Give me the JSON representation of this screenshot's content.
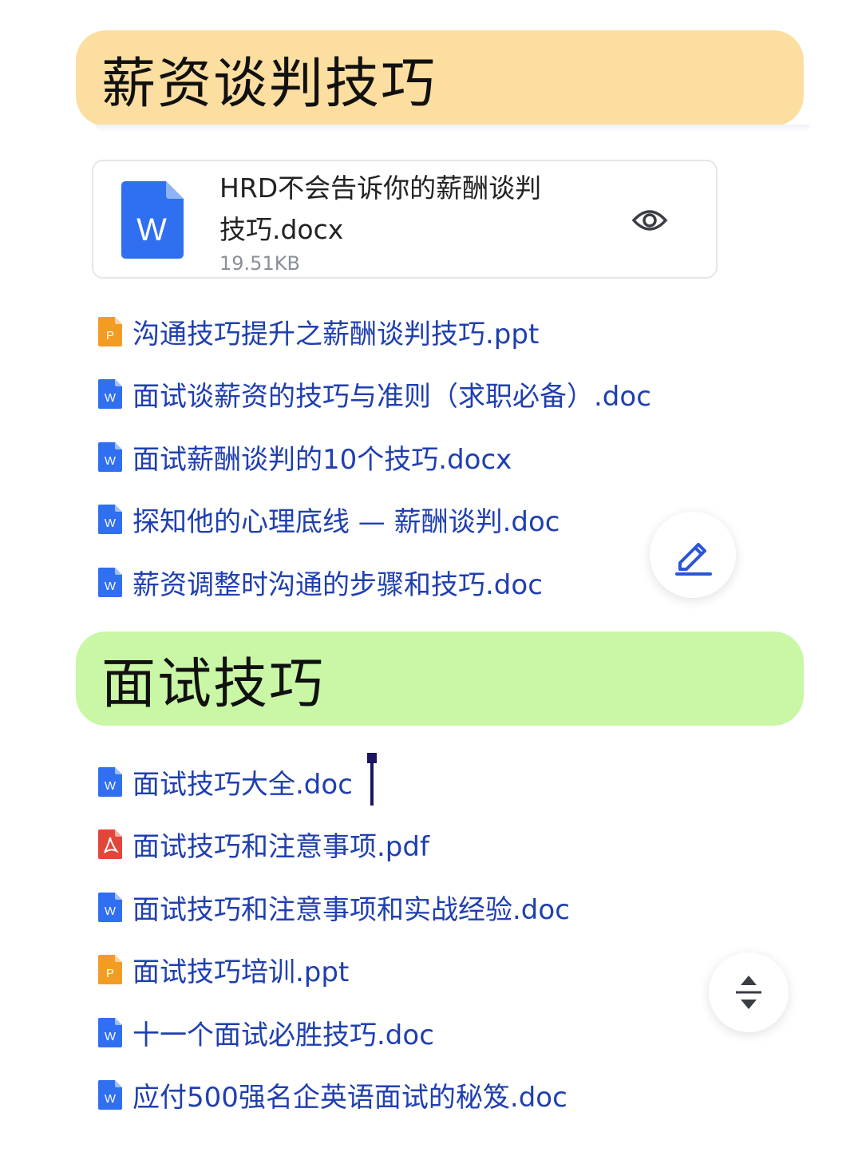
{
  "sections": [
    {
      "title": "薪资谈判技巧",
      "color": "#fbdea0"
    },
    {
      "title": "面试技巧",
      "color": "#c9f7a6"
    }
  ],
  "card": {
    "name_line1": "HRD不会告诉你的薪酬谈判",
    "name_line2": "技巧.docx",
    "size": "19.51KB",
    "icon_letter": "W"
  },
  "files_section1": [
    {
      "name": "沟通技巧提升之薪酬谈判技巧.ppt",
      "type": "ppt",
      "icon_letter": "P"
    },
    {
      "name": "面试谈薪资的技巧与准则（求职必备）.doc",
      "type": "doc",
      "icon_letter": "W"
    },
    {
      "name": "面试薪酬谈判的10个技巧.docx",
      "type": "doc",
      "icon_letter": "W"
    },
    {
      "name": "探知他的心理底线 — 薪酬谈判.doc",
      "type": "doc",
      "icon_letter": "W"
    },
    {
      "name": "薪资调整时沟通的步骤和技巧.doc",
      "type": "doc",
      "icon_letter": "W"
    }
  ],
  "files_section2": [
    {
      "name": "面试技巧大全.doc",
      "type": "doc",
      "icon_letter": "W"
    },
    {
      "name": "面试技巧和注意事项.pdf",
      "type": "pdf",
      "icon_letter": ""
    },
    {
      "name": "面试技巧和注意事项和实战经验.doc",
      "type": "doc",
      "icon_letter": "W"
    },
    {
      "name": "面试技巧培训.ppt",
      "type": "ppt",
      "icon_letter": "P"
    },
    {
      "name": "十一个面试必胜技巧.doc",
      "type": "doc",
      "icon_letter": "W"
    },
    {
      "name": "应付500强名企英语面试的秘笈.doc",
      "type": "doc",
      "icon_letter": "W"
    }
  ],
  "colors": {
    "link": "#1f3fb0",
    "doc": "#2f6ff0",
    "ppt": "#f39c24",
    "pdf": "#e2463a"
  },
  "icons": {
    "edit": "pencil-icon",
    "sort": "expand-collapse-icon",
    "preview": "eye-icon"
  }
}
